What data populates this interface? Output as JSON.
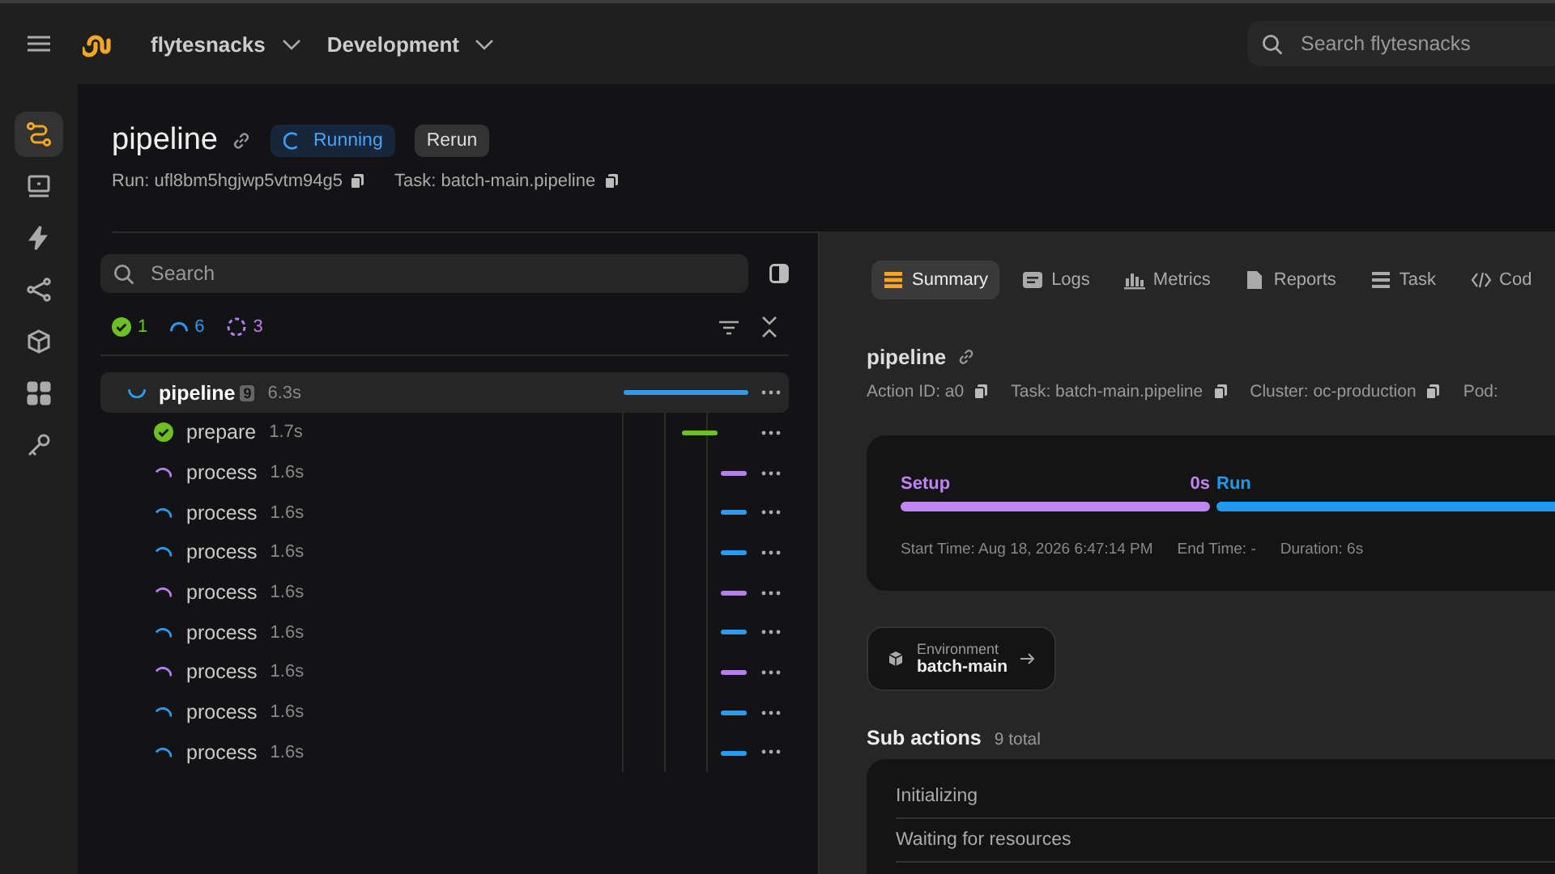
{
  "topbar": {
    "project": "flytesnacks",
    "domain": "Development",
    "search": {
      "placeholder": "Search flytesnacks"
    }
  },
  "rail": [
    {
      "kind": "flow",
      "selected": true
    },
    {
      "kind": "screen",
      "selected": false
    },
    {
      "kind": "bolt",
      "selected": false
    },
    {
      "kind": "share",
      "selected": false
    },
    {
      "kind": "cube",
      "selected": false
    },
    {
      "kind": "apps",
      "selected": false
    },
    {
      "kind": "key",
      "selected": false
    }
  ],
  "run": {
    "title": "pipeline",
    "status": "Running",
    "rerun": "Rerun",
    "run_id": "Run: ufl8bm5hgjwp5vtm94g5",
    "task": "Task: batch-main.pipeline"
  },
  "tree": {
    "search": {
      "placeholder": "Search"
    },
    "counts": [
      {
        "kind": "succeeded",
        "count": "1",
        "color": "#6cc026"
      },
      {
        "kind": "running",
        "count": "6",
        "color": "#2a9bf0"
      },
      {
        "kind": "queued",
        "count": "3",
        "color": "#b67ff0"
      }
    ],
    "nodes": [
      {
        "name": "pipeline",
        "badge": "9",
        "duration": "6.3s",
        "kind": "running",
        "selected": true,
        "children": [
          {
            "name": "prepare",
            "duration": "1.7s",
            "kind": "succeeded",
            "selected": false
          },
          {
            "name": "process",
            "duration": "1.6s",
            "kind": "queued",
            "selected": false
          },
          {
            "name": "process",
            "duration": "1.6s",
            "kind": "running",
            "selected": false
          },
          {
            "name": "process",
            "duration": "1.6s",
            "kind": "running",
            "selected": false
          },
          {
            "name": "process",
            "duration": "1.6s",
            "kind": "queued",
            "selected": false
          },
          {
            "name": "process",
            "duration": "1.6s",
            "kind": "running",
            "selected": false
          },
          {
            "name": "process",
            "duration": "1.6s",
            "kind": "queued",
            "selected": false
          },
          {
            "name": "process",
            "duration": "1.6s",
            "kind": "running",
            "selected": false
          },
          {
            "name": "process",
            "duration": "1.6s",
            "kind": "running",
            "selected": false
          }
        ]
      }
    ]
  },
  "tabs": [
    {
      "label": "Summary",
      "kind": "summary",
      "selected": true
    },
    {
      "label": "Logs",
      "kind": "logs",
      "selected": false
    },
    {
      "label": "Metrics",
      "kind": "metrics",
      "selected": false
    },
    {
      "label": "Reports",
      "kind": "reports",
      "selected": false
    },
    {
      "label": "Task",
      "kind": "task",
      "selected": false
    },
    {
      "label": "Cod",
      "kind": "code",
      "selected": false
    }
  ],
  "action": {
    "title": "pipeline",
    "meta": [
      {
        "text": "Action ID: a0",
        "copy": true
      },
      {
        "text": "Task: batch-main.pipeline",
        "copy": true
      },
      {
        "text": "Cluster: oc-production",
        "copy": true
      },
      {
        "text": "Pod:",
        "copy": false
      }
    ]
  },
  "timeline": {
    "phases": [
      {
        "label": "Setup",
        "duration": "0s",
        "kind": "fixed",
        "color": "#c084f5"
      },
      {
        "label": "Run",
        "kind": "grow",
        "color": "#1e9bf0"
      }
    ],
    "stats": [
      "Start Time: Aug 18, 2026 6:47:14 PM",
      "End Time: -",
      "Duration: 6s"
    ]
  },
  "environment": {
    "label": "Environment",
    "value": "batch-main"
  },
  "sub_actions": {
    "title": "Sub actions",
    "total": "9 total",
    "groups": [
      "Initializing",
      "Waiting for resources"
    ]
  }
}
